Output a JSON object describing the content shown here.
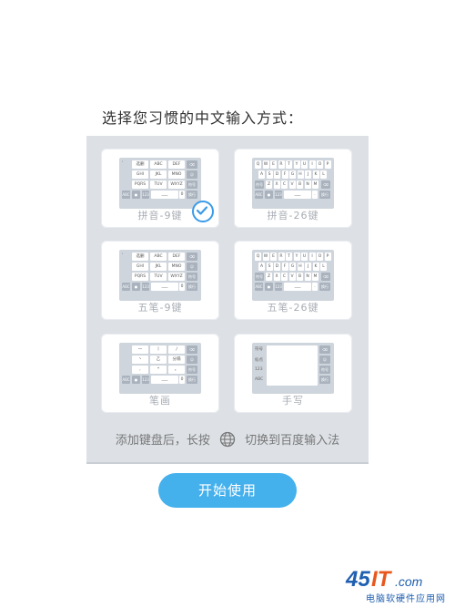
{
  "title": "选择您习惯的中文输入方式：",
  "options": [
    {
      "label": "拼音-9键",
      "selected": true
    },
    {
      "label": "拼音-26键",
      "selected": false
    },
    {
      "label": "五笔-9键",
      "selected": false
    },
    {
      "label": "五笔-26键",
      "selected": false
    },
    {
      "label": "笔画",
      "selected": false
    },
    {
      "label": "手写",
      "selected": false
    }
  ],
  "hint": {
    "before": "添加键盘后，长按",
    "after": "切换到百度输入法"
  },
  "start_button": "开始使用",
  "watermark": {
    "logo": "45IT.com",
    "text": "电脑软硬件应用网"
  },
  "colors": {
    "accent": "#44b0ec",
    "panel": "#dde1e6",
    "check": "#3a9be8"
  }
}
